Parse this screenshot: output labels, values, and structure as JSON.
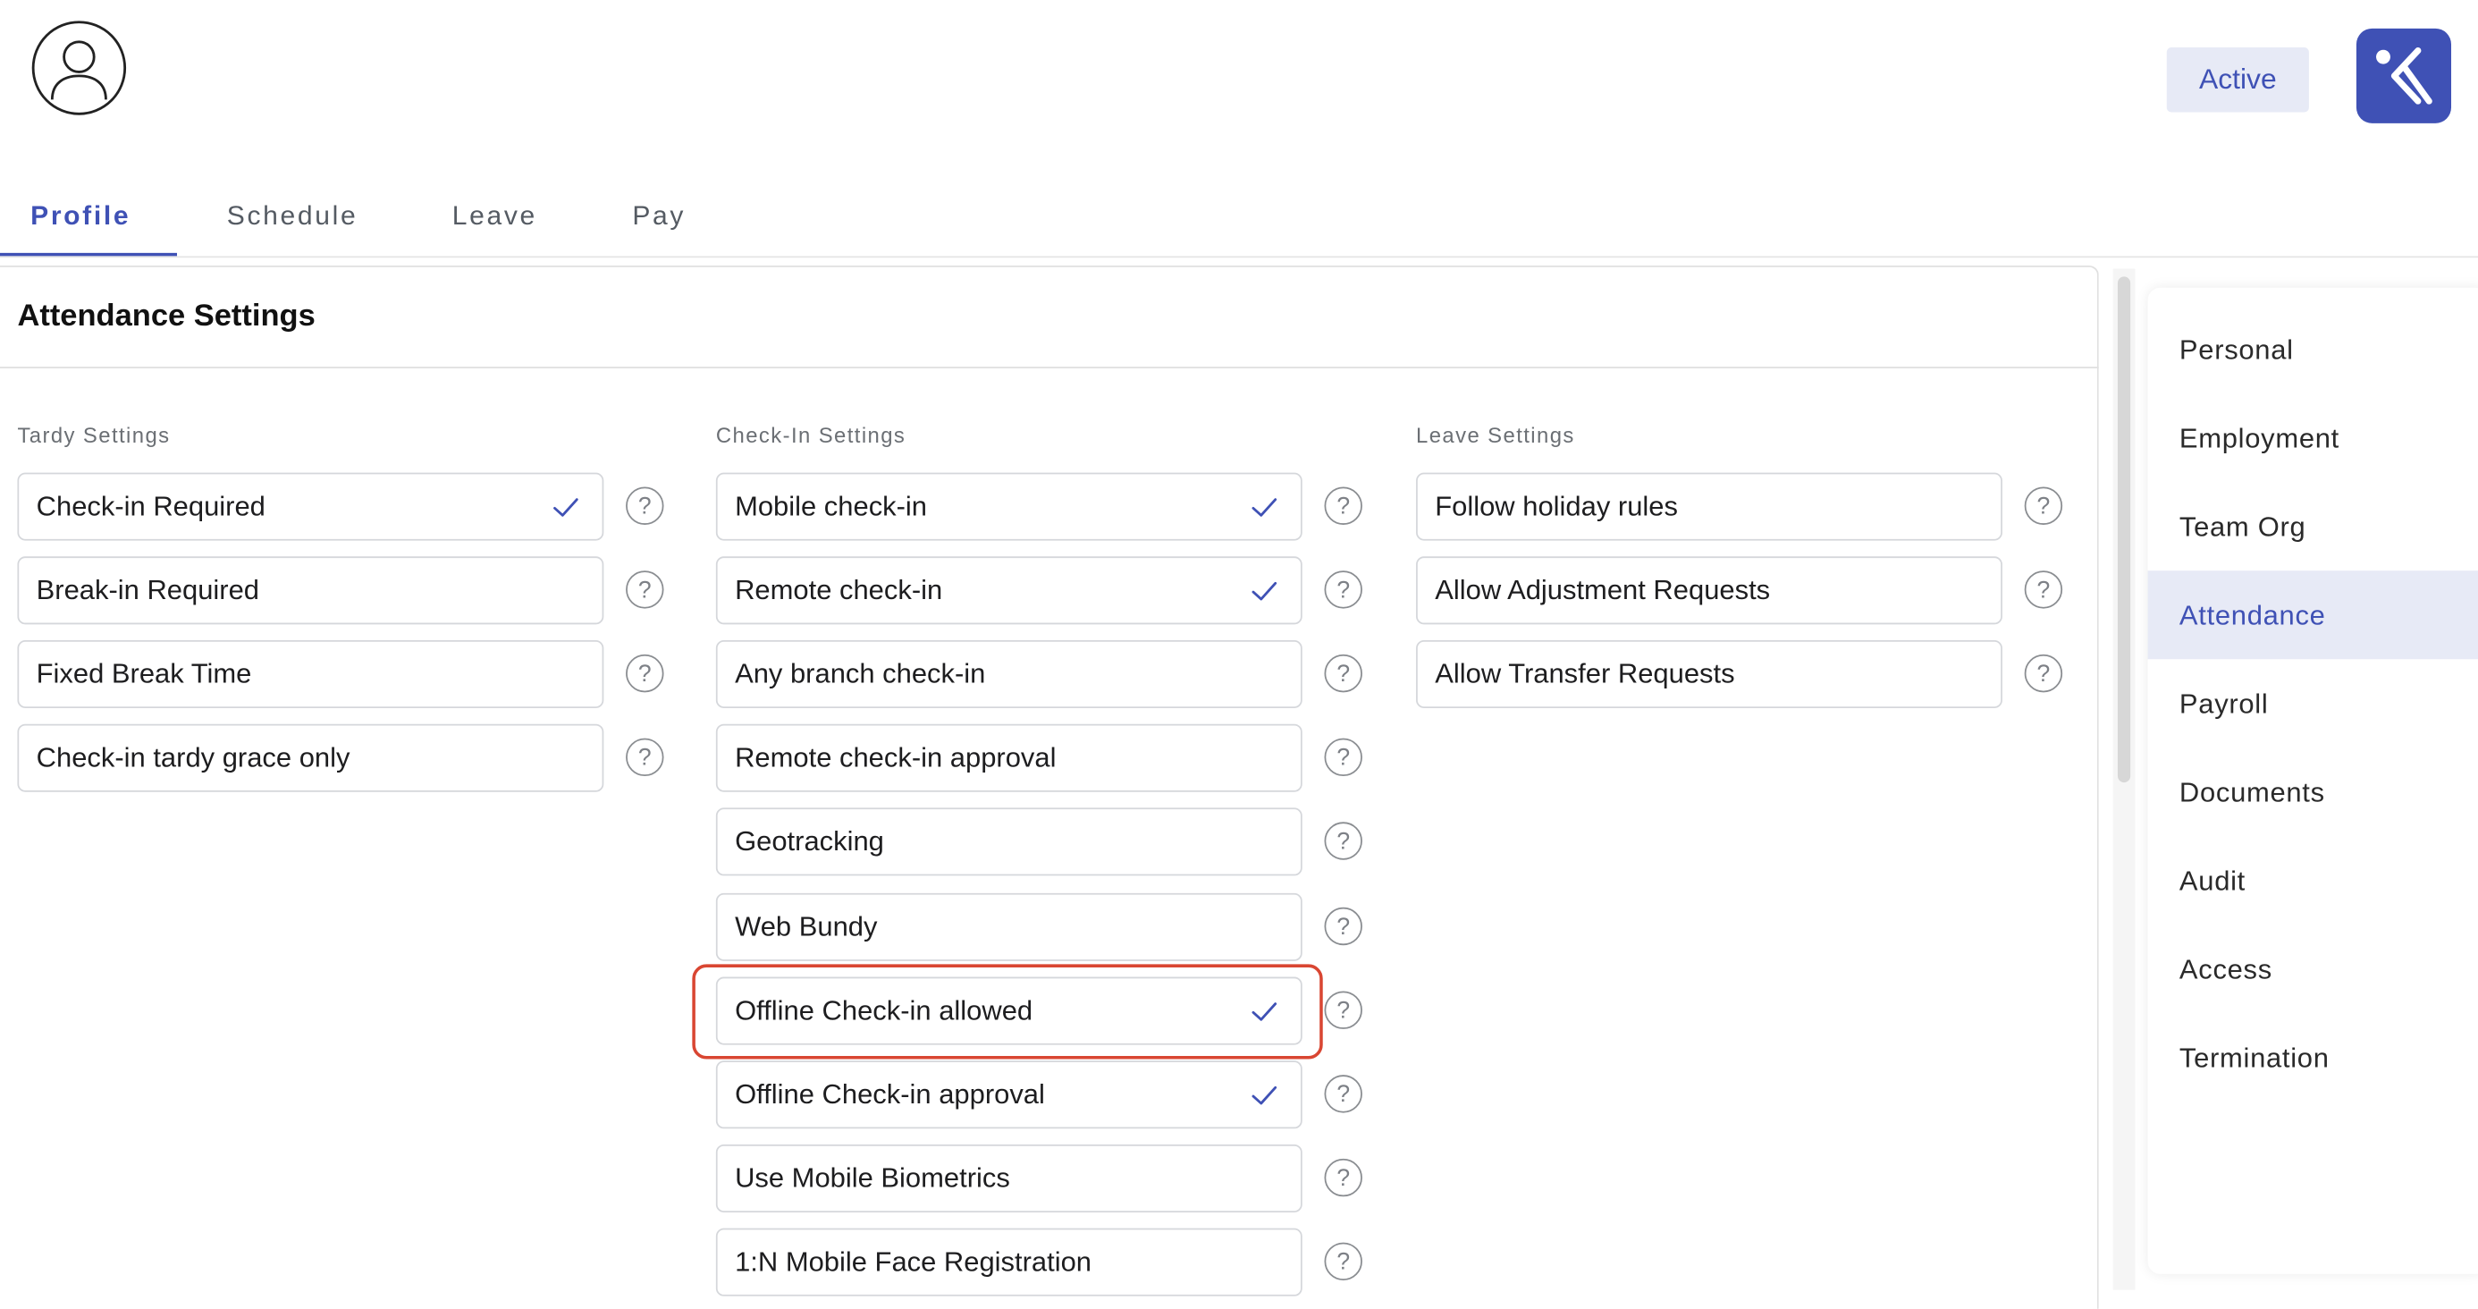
{
  "header": {
    "avatar_icon": "user-avatar-icon",
    "status": "Active",
    "logo_icon": "app-logo-icon"
  },
  "colors": {
    "accent": "#3f51b5",
    "accent_light": "#e7eaf6",
    "highlight": "#d94632"
  },
  "tabs": [
    {
      "label": "Profile",
      "active": true
    },
    {
      "label": "Schedule",
      "active": false
    },
    {
      "label": "Leave",
      "active": false
    },
    {
      "label": "Pay",
      "active": false
    }
  ],
  "page": {
    "title": "Attendance Settings"
  },
  "sections": {
    "tardy": {
      "title": "Tardy Settings",
      "items": [
        {
          "label": "Check-in Required",
          "checked": true
        },
        {
          "label": "Break-in Required",
          "checked": false
        },
        {
          "label": "Fixed Break Time",
          "checked": false
        },
        {
          "label": "Check-in tardy grace only",
          "checked": false
        }
      ]
    },
    "checkin": {
      "title": "Check-In Settings",
      "items": [
        {
          "label": "Mobile check-in",
          "checked": true
        },
        {
          "label": "Remote check-in",
          "checked": true
        },
        {
          "label": "Any branch check-in",
          "checked": false
        },
        {
          "label": "Remote check-in approval",
          "checked": false
        },
        {
          "label": "Geotracking",
          "checked": false
        },
        {
          "label": "Web Bundy",
          "checked": false
        },
        {
          "label": "Offline Check-in allowed",
          "checked": true
        },
        {
          "label": "Offline Check-in approval",
          "checked": true
        },
        {
          "label": "Use Mobile Biometrics",
          "checked": false
        },
        {
          "label": "1:N Mobile Face Registration",
          "checked": false
        }
      ]
    },
    "leave": {
      "title": "Leave Settings",
      "items": [
        {
          "label": "Follow holiday rules",
          "checked": false
        },
        {
          "label": "Allow Adjustment Requests",
          "checked": false
        },
        {
          "label": "Allow Transfer Requests",
          "checked": false
        }
      ]
    }
  },
  "help_glyph": "?",
  "sidebar": {
    "items": [
      {
        "label": "Personal",
        "active": false
      },
      {
        "label": "Employment",
        "active": false
      },
      {
        "label": "Team Org",
        "active": false
      },
      {
        "label": "Attendance",
        "active": true
      },
      {
        "label": "Payroll",
        "active": false
      },
      {
        "label": "Documents",
        "active": false
      },
      {
        "label": "Audit",
        "active": false
      },
      {
        "label": "Access",
        "active": false
      },
      {
        "label": "Termination",
        "active": false
      }
    ]
  }
}
